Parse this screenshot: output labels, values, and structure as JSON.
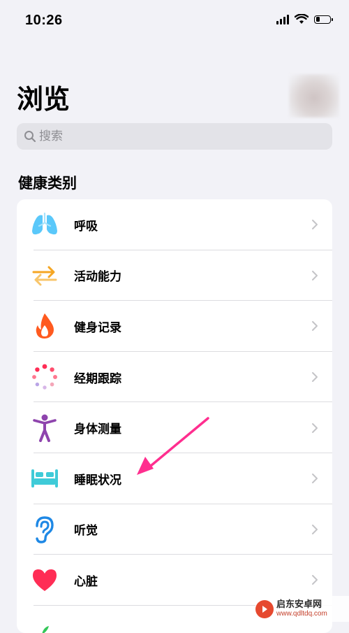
{
  "status_bar": {
    "time": "10:26",
    "battery_level": 0.15,
    "icons": [
      "signal-icon",
      "wifi-icon",
      "battery-icon"
    ]
  },
  "header": {
    "title": "浏览",
    "avatar": "avatar"
  },
  "search": {
    "placeholder": "搜索"
  },
  "section": {
    "title": "健康类别"
  },
  "categories": [
    {
      "label": "呼吸",
      "icon": "lungs-icon",
      "color": "#5ac8fa"
    },
    {
      "label": "活动能力",
      "icon": "arrows-icon",
      "color": "#f5a623"
    },
    {
      "label": "健身记录",
      "icon": "flame-icon",
      "color": "#ff5a1f"
    },
    {
      "label": "经期跟踪",
      "icon": "cycle-tracking-icon",
      "color": "#ff2d55"
    },
    {
      "label": "身体测量",
      "icon": "body-figure-icon",
      "color": "#8e44ad"
    },
    {
      "label": "睡眠状况",
      "icon": "bed-icon",
      "color": "#3fcbd8"
    },
    {
      "label": "听觉",
      "icon": "ear-icon",
      "color": "#1e88e5"
    },
    {
      "label": "心脏",
      "icon": "heart-icon",
      "color": "#ff2d55"
    },
    {
      "label": "",
      "icon": "leaf-icon",
      "color": "#34c759"
    }
  ],
  "annotation": {
    "color": "#ff2e8f"
  },
  "watermark": {
    "title": "启东安卓网",
    "url": "www.qdltdq.com"
  }
}
